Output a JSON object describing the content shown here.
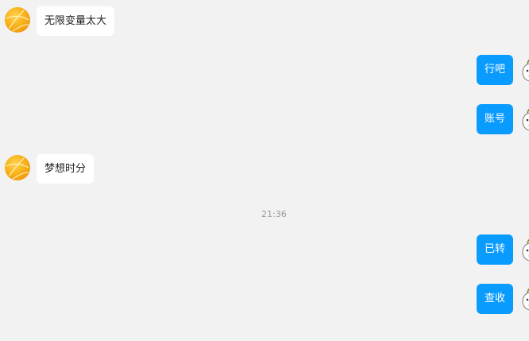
{
  "messages": [
    {
      "side": "left",
      "text": "无限变量太大"
    },
    {
      "side": "right",
      "text": "行吧"
    },
    {
      "side": "right",
      "text": "账号"
    },
    {
      "side": "left",
      "text": "梦想时分"
    },
    {
      "side": "right",
      "text": "已转"
    },
    {
      "side": "right",
      "text": "查收"
    }
  ],
  "timestamp": "21:36",
  "colors": {
    "background": "#f2f2f2",
    "incoming_bubble": "#ffffff",
    "outgoing_bubble": "#0a9bff",
    "timestamp_text": "#999999"
  },
  "icons": {
    "left_avatar": "orange-basketball-avatar-icon",
    "right_avatar": "cartoon-avatar-icon"
  }
}
